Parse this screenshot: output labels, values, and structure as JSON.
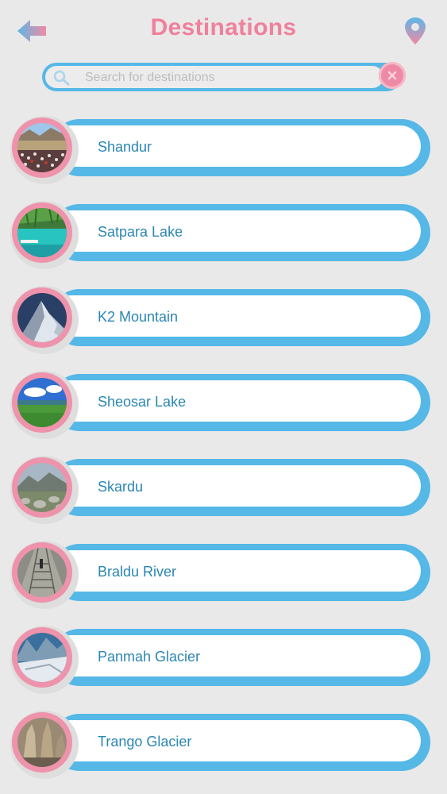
{
  "header": {
    "title": "Destinations",
    "back_icon": "back-arrow-icon",
    "location_icon": "map-pin-icon"
  },
  "search": {
    "placeholder": "Search for destinations",
    "value": "",
    "icon": "search-icon",
    "clear_icon": "close-icon"
  },
  "colors": {
    "accent_pink": "#f0809b",
    "accent_blue": "#55b8e6",
    "label_blue": "#2b86b3",
    "background": "#e9e9e9"
  },
  "destinations": [
    {
      "label": "Shandur",
      "thumbnail": "crowd-festival-photo"
    },
    {
      "label": "Satpara Lake",
      "thumbnail": "turquoise-lake-photo"
    },
    {
      "label": "K2 Mountain",
      "thumbnail": "snow-peak-photo"
    },
    {
      "label": "Sheosar Lake",
      "thumbnail": "green-plateau-lake-photo"
    },
    {
      "label": "Skardu",
      "thumbnail": "rocky-valley-photo"
    },
    {
      "label": "Braldu River",
      "thumbnail": "river-bridge-photo"
    },
    {
      "label": "Panmah Glacier",
      "thumbnail": "glacier-photo"
    },
    {
      "label": "Trango Glacier",
      "thumbnail": "rock-towers-photo"
    }
  ]
}
